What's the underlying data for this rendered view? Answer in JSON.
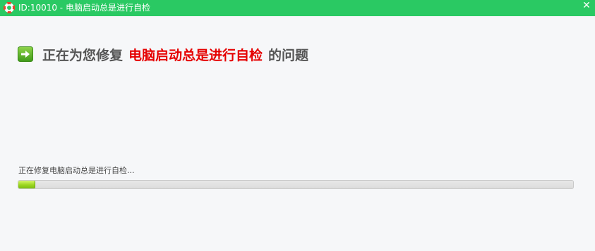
{
  "window": {
    "title": "ID:10010 - 电脑启动总是进行自检",
    "close_glyph": "✕",
    "app_icon": "lifebuoy-icon",
    "accent_color": "#2ac963"
  },
  "heading": {
    "prefix": "正在为您修复",
    "highlight": "电脑启动总是进行自检",
    "suffix": "的问题",
    "icon": "arrow-right-icon",
    "highlight_color": "#e50000"
  },
  "progress": {
    "status_text": "正在修复电脑启动总是进行自检...",
    "percent": 3
  }
}
